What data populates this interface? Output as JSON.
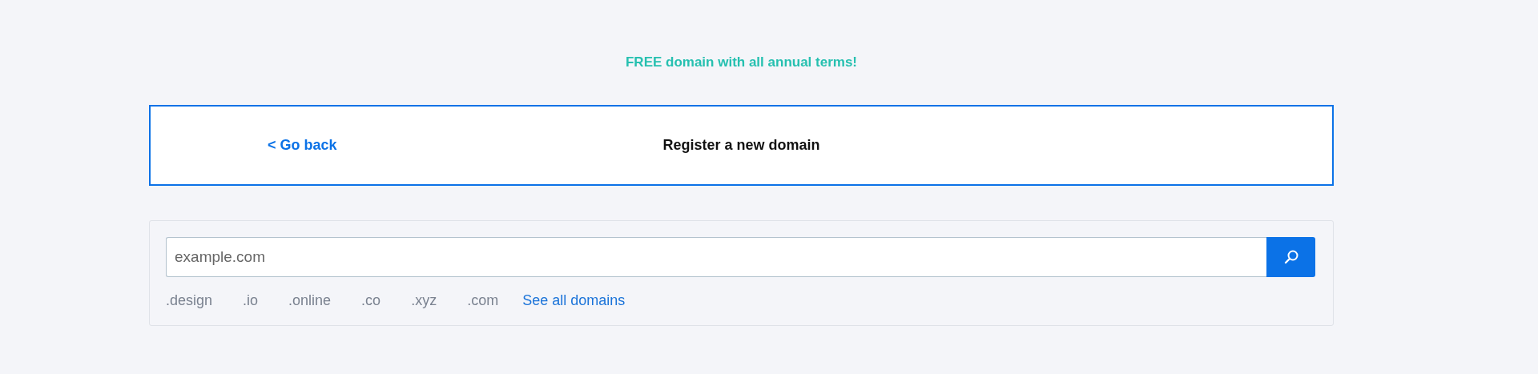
{
  "promo": "FREE domain with all annual terms!",
  "header": {
    "back_link": "< Go back",
    "title": "Register a new domain"
  },
  "search": {
    "placeholder": "example.com"
  },
  "extensions": [
    ".design",
    ".io",
    ".online",
    ".co",
    ".xyz",
    ".com"
  ],
  "see_all_link": "See all domains"
}
